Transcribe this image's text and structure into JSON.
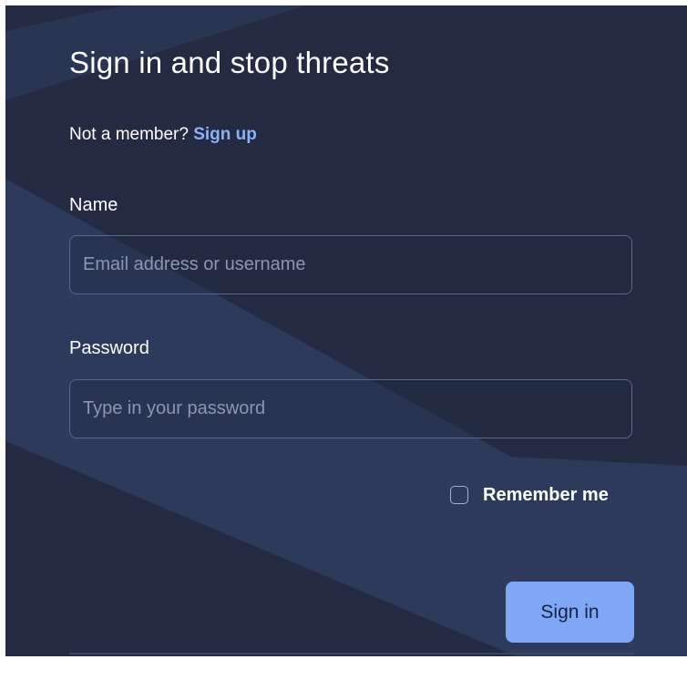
{
  "colors": {
    "background": "#232a42",
    "band": "#2d3a5c",
    "accent_link": "#8ab2f5",
    "button": "#7ea8f5",
    "text": "#ffffff",
    "placeholder": "#8c96ae"
  },
  "form": {
    "title": "Sign in and stop threats",
    "signup_prompt": "Not a member?",
    "signup_link": "Sign up",
    "name_label": "Name",
    "name_placeholder": "Email address or username",
    "name_value": "",
    "password_label": "Password",
    "password_placeholder": "Type in your password",
    "password_value": "",
    "remember_label": "Remember me",
    "remember_checked": false,
    "submit_label": "Sign in"
  }
}
